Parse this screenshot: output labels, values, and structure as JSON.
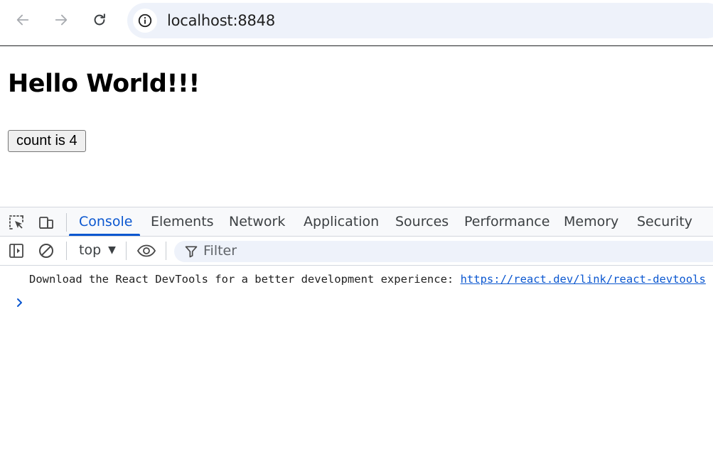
{
  "browser": {
    "url": "localhost:8848",
    "icons": {
      "back": "arrow-left-icon",
      "forward": "arrow-right-icon",
      "reload": "reload-icon",
      "site_info": "info-icon"
    }
  },
  "page": {
    "title": "Hello World!!!",
    "count_button_label": "count is 4"
  },
  "devtools": {
    "tabs": [
      "Console",
      "Elements",
      "Network",
      "Application",
      "Sources",
      "Performance",
      "Memory",
      "Security"
    ],
    "active_tab": "Console",
    "context": "top",
    "filter_placeholder": "Filter",
    "console": {
      "message_text": "Download the React DevTools for a better development experience: ",
      "message_link": "https://react.dev/link/react-devtools"
    }
  },
  "colors": {
    "accent": "#0b57d0",
    "omnibox_bg": "#eef2fa",
    "devtools_header_bg": "#f8f9fb"
  }
}
